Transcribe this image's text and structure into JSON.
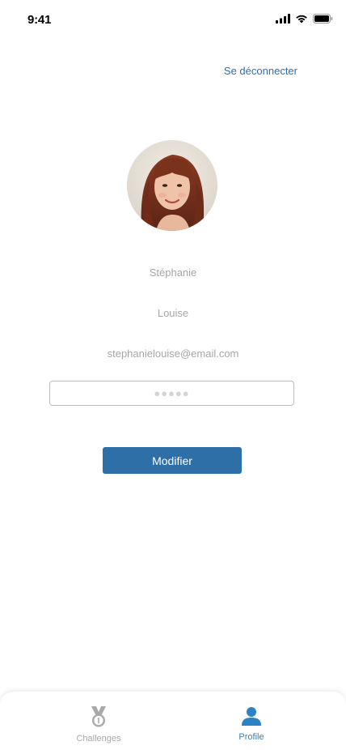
{
  "status_bar": {
    "time": "9:41"
  },
  "header": {
    "logout_label": "Se déconnecter"
  },
  "profile": {
    "first_name": "Stéphanie",
    "last_name": "Louise",
    "email": "stephanielouise@email.com",
    "password_mask": "●●●●●"
  },
  "actions": {
    "modify_label": "Modifier"
  },
  "tab_bar": {
    "items": [
      {
        "label": "Challenges",
        "icon": "medal-icon",
        "active": false
      },
      {
        "label": "Profile",
        "icon": "person-icon",
        "active": true
      }
    ]
  },
  "colors": {
    "accent": "#2f6fa8",
    "active_tab": "#2b83c4",
    "inactive": "#a9a9a9",
    "field_text": "#a6a6a6"
  }
}
